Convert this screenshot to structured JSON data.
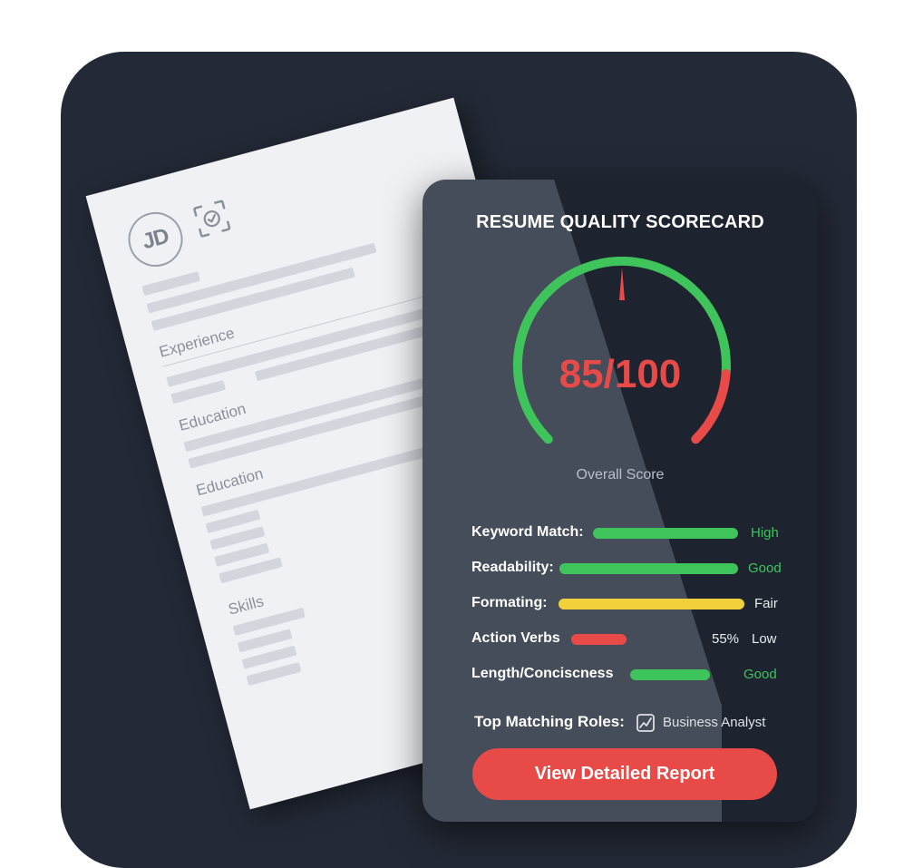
{
  "resume": {
    "initials": "JD",
    "sections": [
      "Experience",
      "Education",
      "Education",
      "Skills"
    ]
  },
  "scorecard": {
    "title": "RESUME QUALITY SCORECARD",
    "score_text": "85/100",
    "score_value": 85,
    "score_max": 100,
    "score_label": "Overall Score",
    "metrics": [
      {
        "name": "Keyword Match:",
        "value": "High",
        "fill": 0.95,
        "color": "#3ec45a",
        "value_color": "#3ec45a"
      },
      {
        "name": "Readability:",
        "value": "Good",
        "fill": 0.97,
        "color": "#3ec45a",
        "value_color": "#3ec45a"
      },
      {
        "name": "Formating:",
        "value": "Fair",
        "fill": 1.0,
        "color": "#f2d03c",
        "value_color": "#e7ebf0"
      },
      {
        "name": "Action Verbs",
        "percent": "55%",
        "value": "Low",
        "fill": 0.55,
        "color": "#e84a47",
        "value_color": "#e7ebf0"
      },
      {
        "name": "Length/Conciscness",
        "value": "Good",
        "fill": 0.9,
        "color": "#3ec45a",
        "value_color": "#3ec45a"
      }
    ],
    "roles_label": "Top Matching Roles:",
    "roles_value": "Business Analyst",
    "cta_label": "View Detailed Report"
  },
  "colors": {
    "background": "#232936",
    "card": "#1e2330",
    "accent_red": "#e84a47",
    "accent_green": "#3ec45a",
    "accent_yellow": "#f2d03c"
  },
  "icons": [
    "face-scan-check-icon",
    "trend-chart-icon"
  ]
}
